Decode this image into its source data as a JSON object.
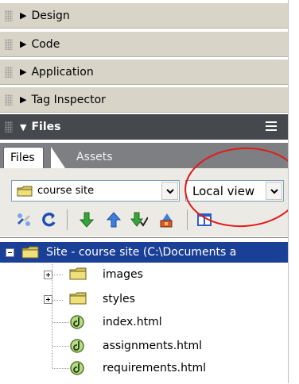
{
  "panels": {
    "collapsed": [
      {
        "label": "Design"
      },
      {
        "label": "Code"
      },
      {
        "label": "Application"
      },
      {
        "label": "Tag Inspector"
      }
    ],
    "files": {
      "label": "Files"
    }
  },
  "tabs": {
    "files": "Files",
    "assets": "Assets"
  },
  "controls": {
    "site_select": "course site",
    "view_select": "Local view"
  },
  "toolbar_icons": [
    "connect-icon",
    "refresh-icon",
    "get-files-icon",
    "put-files-icon",
    "check-out-icon",
    "check-in-icon",
    "expand-icon"
  ],
  "tree": {
    "root": "Site - course site (C:\\Documents a",
    "items": [
      {
        "name": "images",
        "type": "folder"
      },
      {
        "name": "styles",
        "type": "folder"
      },
      {
        "name": "index.html",
        "type": "file"
      },
      {
        "name": "assignments.html",
        "type": "file"
      },
      {
        "name": "requirements.html",
        "type": "file"
      }
    ]
  },
  "colors": {
    "panel_header": "#d8d4c8",
    "files_header": "#45484d",
    "tab_bar": "#7d7f83",
    "selection": "#1a3f97",
    "annotation_ellipse": "#e21a1a"
  }
}
